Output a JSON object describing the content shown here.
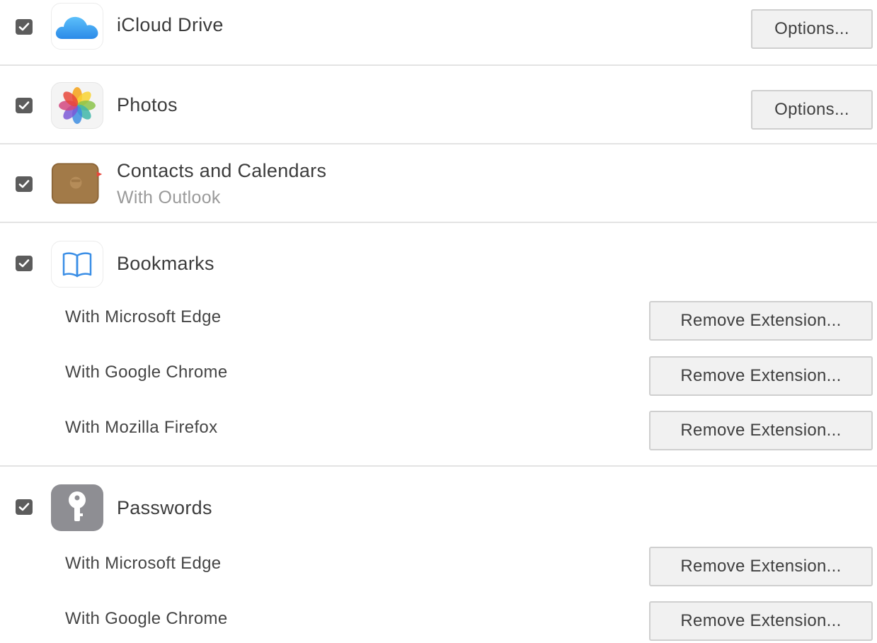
{
  "services": [
    {
      "id": "icloud-drive",
      "label": "iCloud Drive",
      "checked": true,
      "icon": "cloud-icon",
      "button_label": "Options..."
    },
    {
      "id": "photos",
      "label": "Photos",
      "checked": true,
      "icon": "photos-icon",
      "button_label": "Options..."
    },
    {
      "id": "contacts-calendars",
      "label": "Contacts and Calendars",
      "sublabel": "With Outlook",
      "checked": true,
      "icon": "contacts-calendars-icon"
    },
    {
      "id": "bookmarks",
      "label": "Bookmarks",
      "checked": true,
      "icon": "book-icon",
      "browsers": [
        {
          "label": "With Microsoft Edge",
          "button_label": "Remove Extension..."
        },
        {
          "label": "With Google Chrome",
          "button_label": "Remove Extension..."
        },
        {
          "label": "With Mozilla Firefox",
          "button_label": "Remove Extension..."
        }
      ]
    },
    {
      "id": "passwords",
      "label": "Passwords",
      "checked": true,
      "icon": "key-icon",
      "browsers": [
        {
          "label": "With Microsoft Edge",
          "button_label": "Remove Extension..."
        },
        {
          "label": "With Google Chrome",
          "button_label": "Remove Extension..."
        }
      ]
    }
  ],
  "colors": {
    "checkbox": "#5c5c5c",
    "cloud": "#3aa0f0",
    "divider": "#e3e3e3",
    "button_bg": "#f1f1f1",
    "sublabel": "#9a9a9a"
  }
}
